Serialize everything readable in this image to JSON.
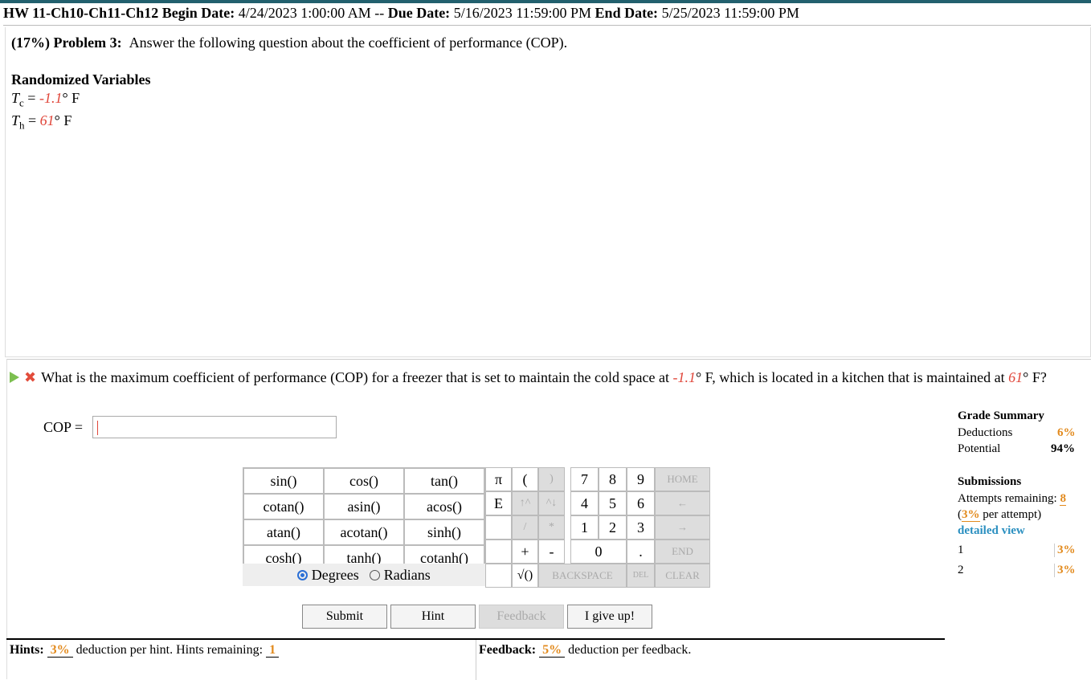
{
  "header": {
    "hw_title": "HW 11-Ch10-Ch11-Ch12",
    "begin_label": "Begin Date:",
    "begin_value": "4/24/2023 1:00:00 AM",
    "sep": "--",
    "due_label": "Due Date:",
    "due_value": "5/16/2023 11:59:00 PM",
    "end_label": "End Date:",
    "end_value": "5/25/2023 11:59:00 PM"
  },
  "problem": {
    "percent": "(17%)",
    "label": "Problem 3:",
    "text": "Answer the following question about the coefficient of performance (COP)."
  },
  "randomized": {
    "title": "Randomized Variables",
    "vars": [
      {
        "sym": "T",
        "sub": "c",
        "eq": " = ",
        "value": "-1.1",
        "unit": "° F"
      },
      {
        "sym": "T",
        "sub": "h",
        "eq": " = ",
        "value": "61",
        "unit": "° F"
      }
    ]
  },
  "question": {
    "part1": "What is the maximum coefficient of performance (COP) for a freezer that is set to maintain the cold space at ",
    "val1": "-1.1",
    "part2": "° F, which is located in a kitchen that is maintained at ",
    "val2": "61",
    "part3": "° F?"
  },
  "answer": {
    "label": "COP =",
    "value": ""
  },
  "functions": [
    [
      "sin()",
      "cos()",
      "tan()"
    ],
    [
      "cotan()",
      "asin()",
      "acos()"
    ],
    [
      "atan()",
      "acotan()",
      "sinh()"
    ],
    [
      "cosh()",
      "tanh()",
      "cotanh()"
    ]
  ],
  "angle": {
    "degrees": "Degrees",
    "radians": "Radians"
  },
  "keys": {
    "pi": "π",
    "lparen": "(",
    "rparen": ")",
    "k7": "7",
    "k8": "8",
    "k9": "9",
    "home": "HOME",
    "e": "E",
    "up": "↑^",
    "down": "^↓",
    "k4": "4",
    "k5": "5",
    "k6": "6",
    "left": "←",
    "div": "/",
    "mul": "*",
    "k1": "1",
    "k2": "2",
    "k3": "3",
    "right": "→",
    "plus": "+",
    "minus": "-",
    "k0": "0",
    "dot": ".",
    "end": "END",
    "sqrt": "√()",
    "backspace": "BACKSPACE",
    "del": "DEL",
    "clear": "CLEAR"
  },
  "buttons": {
    "submit": "Submit",
    "hint": "Hint",
    "feedback": "Feedback",
    "giveup": "I give up!"
  },
  "hints": {
    "label": "Hints:",
    "pct": "3%",
    "text": "deduction per hint. Hints remaining:",
    "remaining": "1"
  },
  "feedback": {
    "label": "Feedback:",
    "pct": "5%",
    "text": "deduction per feedback."
  },
  "grade_summary": {
    "title": "Grade Summary",
    "deductions_label": "Deductions",
    "deductions_value": "6%",
    "potential_label": "Potential",
    "potential_value": "94%"
  },
  "submissions": {
    "title": "Submissions",
    "attempts_label": "Attempts remaining:",
    "attempts_value": "8",
    "per_pct": "3%",
    "per_text": "per attempt)",
    "open_paren": "(",
    "detailed": "detailed view",
    "rows": [
      {
        "n": "1",
        "pct": "3%"
      },
      {
        "n": "2",
        "pct": "3%"
      }
    ]
  },
  "colors": {
    "accent_bar": "#22606e",
    "variable": "#e0463a",
    "orange": "#e28a1d",
    "link": "#2a8fc0"
  }
}
